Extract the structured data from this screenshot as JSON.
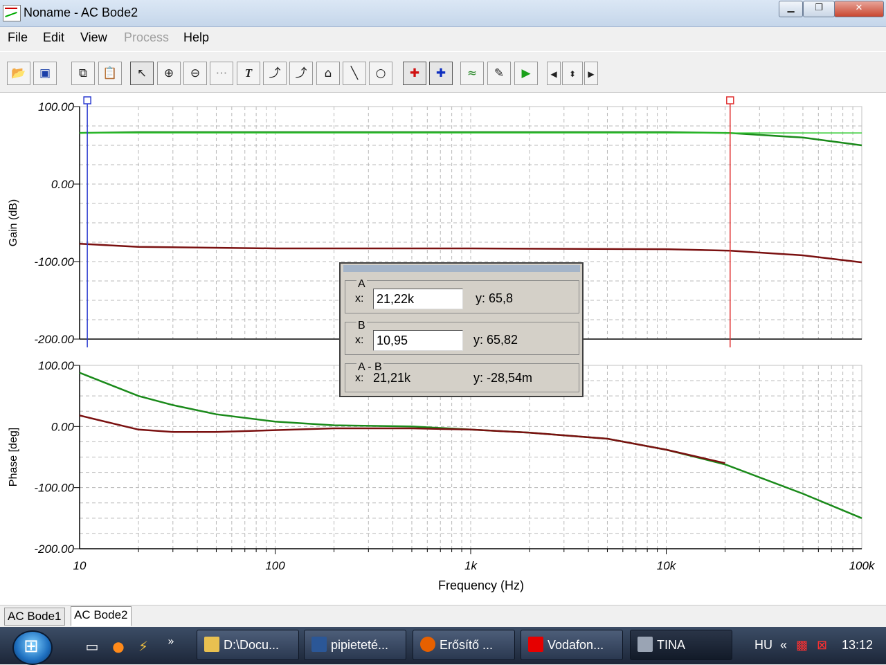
{
  "window": {
    "title": "Noname - AC Bode2"
  },
  "menu": [
    {
      "label": "File",
      "enabled": true
    },
    {
      "label": "Edit",
      "enabled": true
    },
    {
      "label": "View",
      "enabled": true
    },
    {
      "label": "Process",
      "enabled": false
    },
    {
      "label": "Help",
      "enabled": true
    }
  ],
  "chart_data": [
    {
      "type": "line",
      "ylabel": "Gain (dB)",
      "xscale": "log",
      "xlim": [
        10,
        100000
      ],
      "ylim": [
        -200,
        100
      ],
      "yticks": [
        100,
        0,
        -100,
        -200
      ],
      "ytick_labels": [
        "100.00",
        "0.00",
        "-100.00",
        "-200.00"
      ],
      "grid": true,
      "series": [
        {
          "color": "#1a8a1a",
          "x": [
            10,
            20,
            100,
            1000,
            10000,
            21220,
            50000,
            100000
          ],
          "y": [
            66,
            67,
            67,
            67,
            67,
            65.8,
            60,
            50
          ]
        },
        {
          "color": "#7a1010",
          "x": [
            10,
            20,
            100,
            1000,
            10000,
            21220,
            50000,
            100000
          ],
          "y": [
            -77,
            -81,
            -83,
            -83,
            -84,
            -86,
            -92,
            -101
          ]
        },
        {
          "color": "#33cc33",
          "x": [
            10,
            100000
          ],
          "y": [
            66,
            66
          ]
        }
      ],
      "cursors": [
        {
          "name": "a",
          "x": 21220,
          "color": "#e03030"
        },
        {
          "name": "b",
          "x": 10.95,
          "color": "#2a3ad0"
        }
      ]
    },
    {
      "type": "line",
      "ylabel": "Phase [deg]",
      "xlabel": "Frequency (Hz)",
      "xscale": "log",
      "xlim": [
        10,
        100000
      ],
      "ylim": [
        -200,
        100
      ],
      "yticks": [
        100,
        0,
        -100,
        -200
      ],
      "ytick_labels": [
        "100.00",
        "0.00",
        "-100.00",
        "-200.00"
      ],
      "xticks": [
        10,
        100,
        1000,
        10000,
        100000
      ],
      "xtick_labels": [
        "10",
        "100",
        "1k",
        "10k",
        "100k"
      ],
      "grid": true,
      "series": [
        {
          "color": "#1a8a1a",
          "x": [
            10,
            20,
            30,
            50,
            100,
            200,
            500,
            1000,
            2000,
            5000,
            10000,
            20000,
            50000,
            100000
          ],
          "y": [
            88,
            50,
            35,
            20,
            8,
            2,
            0,
            -5,
            -10,
            -20,
            -38,
            -62,
            -110,
            -150
          ]
        },
        {
          "color": "#7a1010",
          "x": [
            10,
            20,
            30,
            50,
            100,
            200,
            500,
            1000,
            2000,
            5000,
            10000,
            20000
          ],
          "y": [
            18,
            -5,
            -9,
            -9,
            -6,
            -3,
            -3,
            -5,
            -10,
            -20,
            -38,
            -60
          ]
        }
      ]
    }
  ],
  "cursor_panel": {
    "a_label": "A",
    "a_x_label": "x:",
    "a_x": "21,22k",
    "a_y": "y: 65,8",
    "b_label": "B",
    "b_x_label": "x:",
    "b_x": "10,95",
    "b_y": "y: 65,82",
    "diff_label": "A - B",
    "diff_x_label": "x:",
    "diff_x": "21,21k",
    "diff_y": "y: -28,54m"
  },
  "tabs": [
    {
      "label": "AC Bode1",
      "active": false
    },
    {
      "label": "AC Bode2",
      "active": true
    }
  ],
  "taskbar": {
    "tasks": [
      {
        "label": "D:\\Docu...",
        "icon": "folder-icon",
        "color": "#e8c050"
      },
      {
        "label": "pipieteté...",
        "icon": "word-icon",
        "color": "#2b5797"
      },
      {
        "label": "Erősítő ...",
        "icon": "firefox-icon",
        "color": "#e66000"
      },
      {
        "label": "Vodafon...",
        "icon": "vodafone-icon",
        "color": "#e60000"
      },
      {
        "label": "TINA",
        "icon": "tina-icon",
        "color": "#9aa4b4"
      }
    ],
    "language": "HU",
    "chevron": "«",
    "clock": "13:12",
    "quicklaunch_more": "»"
  }
}
